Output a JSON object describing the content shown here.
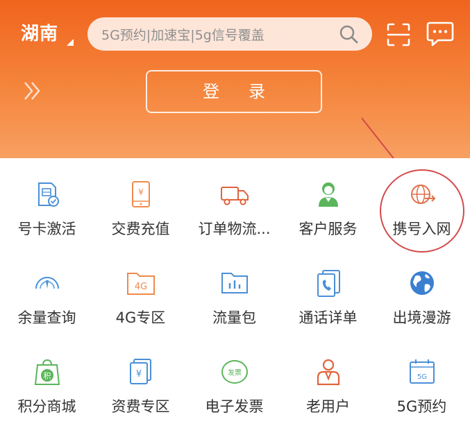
{
  "header": {
    "region": "湖南",
    "search_placeholder": "5G预约|加速宝|5g信号覆盖",
    "login_label": "登录"
  },
  "colors": {
    "header_orange": "#f0641e",
    "icon_orange": "#f08a4b",
    "icon_blue": "#4a8fd6",
    "icon_green": "#5bb55b",
    "annotation_red": "#d24a4a"
  },
  "grid": {
    "items": [
      {
        "label": "号卡激活",
        "icon": "sim-card-icon"
      },
      {
        "label": "交费充值",
        "icon": "phone-yen-icon"
      },
      {
        "label": "订单物流...",
        "icon": "truck-icon"
      },
      {
        "label": "客户服务",
        "icon": "customer-service-icon"
      },
      {
        "label": "携号入网",
        "icon": "globe-arrow-icon"
      },
      {
        "label": "余量查询",
        "icon": "gauge-icon"
      },
      {
        "label": "4G专区",
        "icon": "4g-folder-icon"
      },
      {
        "label": "流量包",
        "icon": "data-chart-icon"
      },
      {
        "label": "通话详单",
        "icon": "call-record-icon"
      },
      {
        "label": "出境漫游",
        "icon": "earth-icon"
      },
      {
        "label": "积分商城",
        "icon": "points-bag-icon"
      },
      {
        "label": "资费专区",
        "icon": "tariff-yen-icon"
      },
      {
        "label": "电子发票",
        "icon": "invoice-icon"
      },
      {
        "label": "老用户",
        "icon": "old-user-icon"
      },
      {
        "label": "5G预约",
        "icon": "5g-calendar-icon"
      }
    ]
  }
}
